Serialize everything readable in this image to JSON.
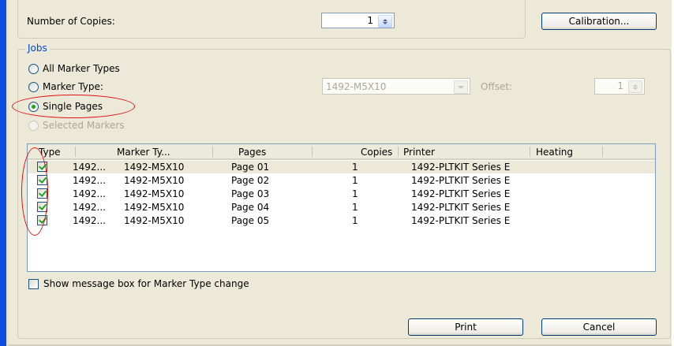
{
  "copies": {
    "label": "Number of Copies:",
    "value": "1"
  },
  "calibration_button": "Calibration...",
  "jobs": {
    "legend": "Jobs",
    "radios": {
      "all": "All Marker Types",
      "marker_type": "Marker Type:",
      "single_pages": "Single Pages",
      "selected_markers": "Selected Markers"
    },
    "marker_type_value": "1492-M5X10",
    "offset": {
      "label": "Offset:",
      "value": "1"
    }
  },
  "table": {
    "columns": [
      "Type",
      "Marker Ty...",
      "Pages",
      "Copies",
      "Printer",
      "Heating"
    ],
    "rows": [
      {
        "checked": true,
        "type": "1492...",
        "marker": "1492-M5X10",
        "pages": "Page 01",
        "copies": "1",
        "printer": "1492-PLTKIT Series E",
        "heating": ""
      },
      {
        "checked": true,
        "type": "1492...",
        "marker": "1492-M5X10",
        "pages": "Page 02",
        "copies": "1",
        "printer": "1492-PLTKIT Series E",
        "heating": ""
      },
      {
        "checked": true,
        "type": "1492...",
        "marker": "1492-M5X10",
        "pages": "Page 03",
        "copies": "1",
        "printer": "1492-PLTKIT Series E",
        "heating": ""
      },
      {
        "checked": true,
        "type": "1492...",
        "marker": "1492-M5X10",
        "pages": "Page 04",
        "copies": "1",
        "printer": "1492-PLTKIT Series E",
        "heating": ""
      },
      {
        "checked": true,
        "type": "1492...",
        "marker": "1492-M5X10",
        "pages": "Page 05",
        "copies": "1",
        "printer": "1492-PLTKIT Series E",
        "heating": ""
      }
    ]
  },
  "show_message_checkbox": "Show message box for Marker Type change",
  "print_button": "Print",
  "cancel_button": "Cancel",
  "colors": {
    "accent_blue": "#0046d5",
    "highlight_red": "#e01010",
    "check_green": "#21a121"
  }
}
